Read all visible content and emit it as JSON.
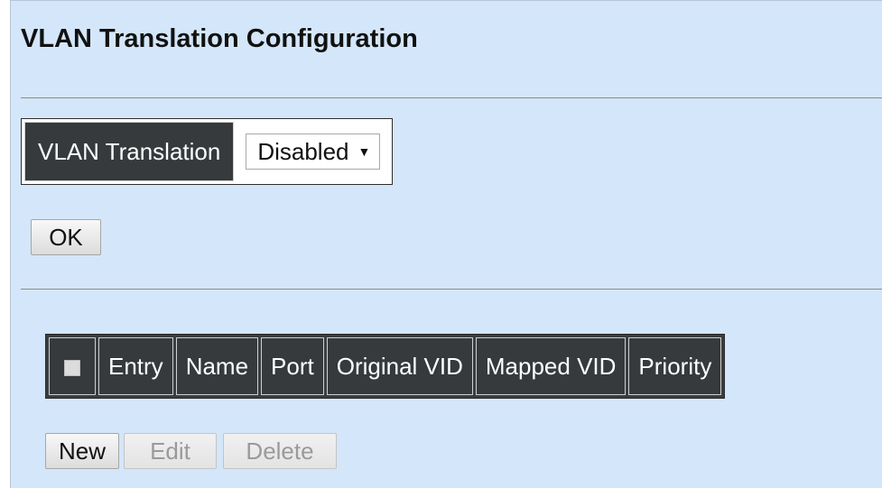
{
  "page": {
    "title": "VLAN Translation Configuration"
  },
  "config": {
    "vlan_translation_label": "VLAN Translation",
    "vlan_translation_value": "Disabled",
    "ok_label": "OK"
  },
  "table": {
    "columns": [
      "Entry",
      "Name",
      "Port",
      "Original VID",
      "Mapped VID",
      "Priority"
    ],
    "rows": []
  },
  "actions": {
    "new_label": "New",
    "edit_label": "Edit",
    "delete_label": "Delete"
  },
  "icons": {
    "select_arrow": "caret-down-icon",
    "select_all": "checkbox-icon"
  }
}
